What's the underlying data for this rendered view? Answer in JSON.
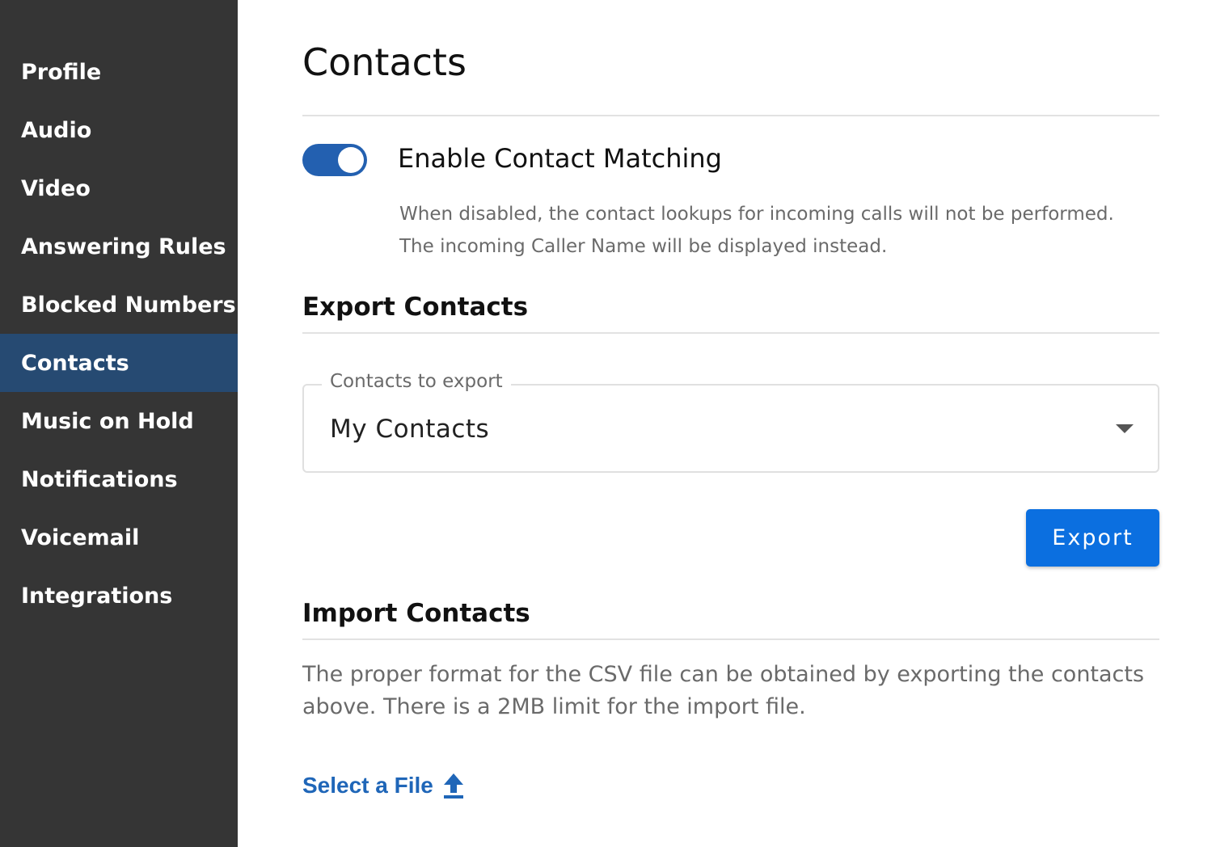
{
  "sidebar": {
    "items": [
      {
        "label": "Profile",
        "active": false
      },
      {
        "label": "Audio",
        "active": false
      },
      {
        "label": "Video",
        "active": false
      },
      {
        "label": "Answering Rules",
        "active": false
      },
      {
        "label": "Blocked Numbers",
        "active": false
      },
      {
        "label": "Contacts",
        "active": true
      },
      {
        "label": "Music on Hold",
        "active": false
      },
      {
        "label": "Notifications",
        "active": false
      },
      {
        "label": "Voicemail",
        "active": false
      },
      {
        "label": "Integrations",
        "active": false
      }
    ]
  },
  "main": {
    "title": "Contacts",
    "contact_matching": {
      "label": "Enable Contact Matching",
      "enabled": true,
      "help_line1": "When disabled, the contact lookups for incoming calls will not be performed.",
      "help_line2": "The incoming Caller Name will be displayed instead."
    },
    "export": {
      "heading": "Export Contacts",
      "select_label": "Contacts to export",
      "select_value": "My Contacts",
      "button_label": "Export"
    },
    "import": {
      "heading": "Import Contacts",
      "description": "The proper format for the CSV file can be obtained by exporting the contacts above. There is a 2MB limit for the import file.",
      "select_file_label": "Select a File"
    }
  },
  "colors": {
    "sidebar_bg": "#353535",
    "sidebar_active": "#264a72",
    "accent": "#2360b0",
    "button": "#0b6fe0",
    "link": "#1f66b8"
  },
  "icons": {
    "toggle": "toggle-switch",
    "dropdown": "caret-down-icon",
    "upload": "upload-icon"
  }
}
